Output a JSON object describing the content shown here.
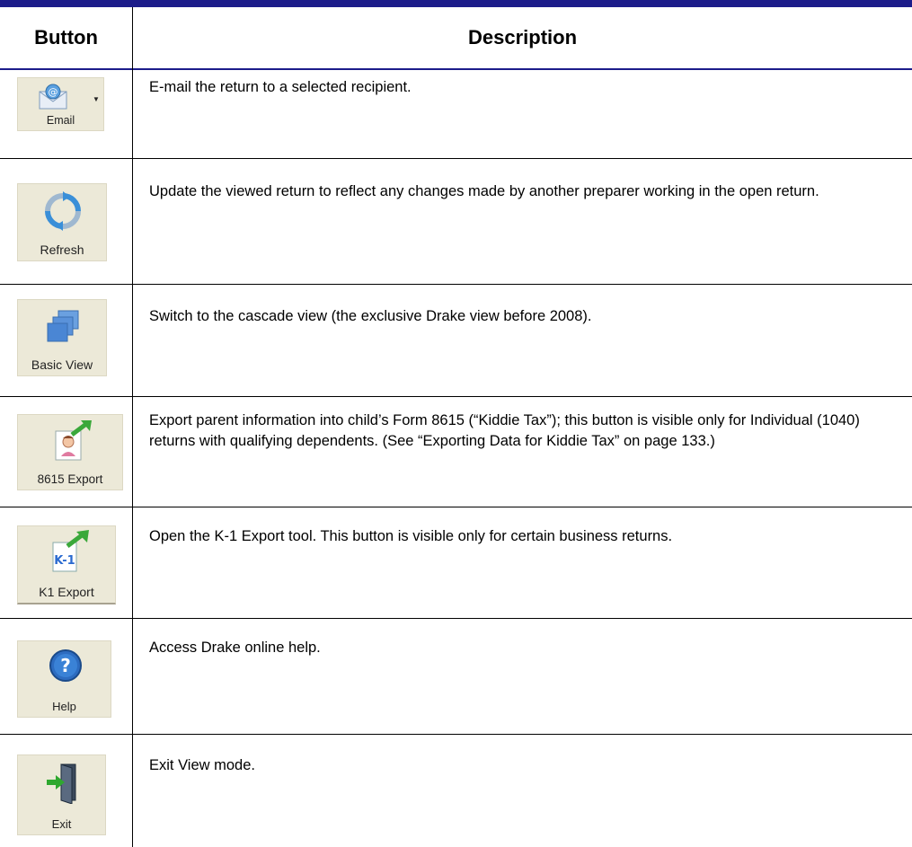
{
  "table": {
    "headers": {
      "button": "Button",
      "description": "Description"
    },
    "rows": [
      {
        "button_label": "Email",
        "icon": "email-icon",
        "description": "E-mail the return to a selected recipient."
      },
      {
        "button_label": "Refresh",
        "icon": "refresh-icon",
        "description": "Update the viewed return to reflect any changes made by another preparer working in the open return."
      },
      {
        "button_label": "Basic View",
        "icon": "basic-view-icon",
        "description": "Switch to the cascade view (the exclusive Drake view before 2008)."
      },
      {
        "button_label": "8615 Export",
        "icon": "kiddie-export-icon",
        "description": "Export parent information into child’s Form 8615 (“Kiddie Tax”); this button is visible only for Individual (1040) returns with qualifying dependents. (See “Exporting Data for Kiddie Tax” on page 133.)"
      },
      {
        "button_label": "K1 Export",
        "icon": "k1-export-icon",
        "icon_text": "K-1",
        "description": "Open the K-1 Export tool. This button is visible only for certain business returns."
      },
      {
        "button_label": "Help",
        "icon": "help-icon",
        "description": "Access Drake online help."
      },
      {
        "button_label": "Exit",
        "icon": "exit-door-icon",
        "description": "Exit View mode."
      }
    ]
  },
  "colors": {
    "rule": "#1c1c8a",
    "button_bg": "#ece9d8"
  }
}
